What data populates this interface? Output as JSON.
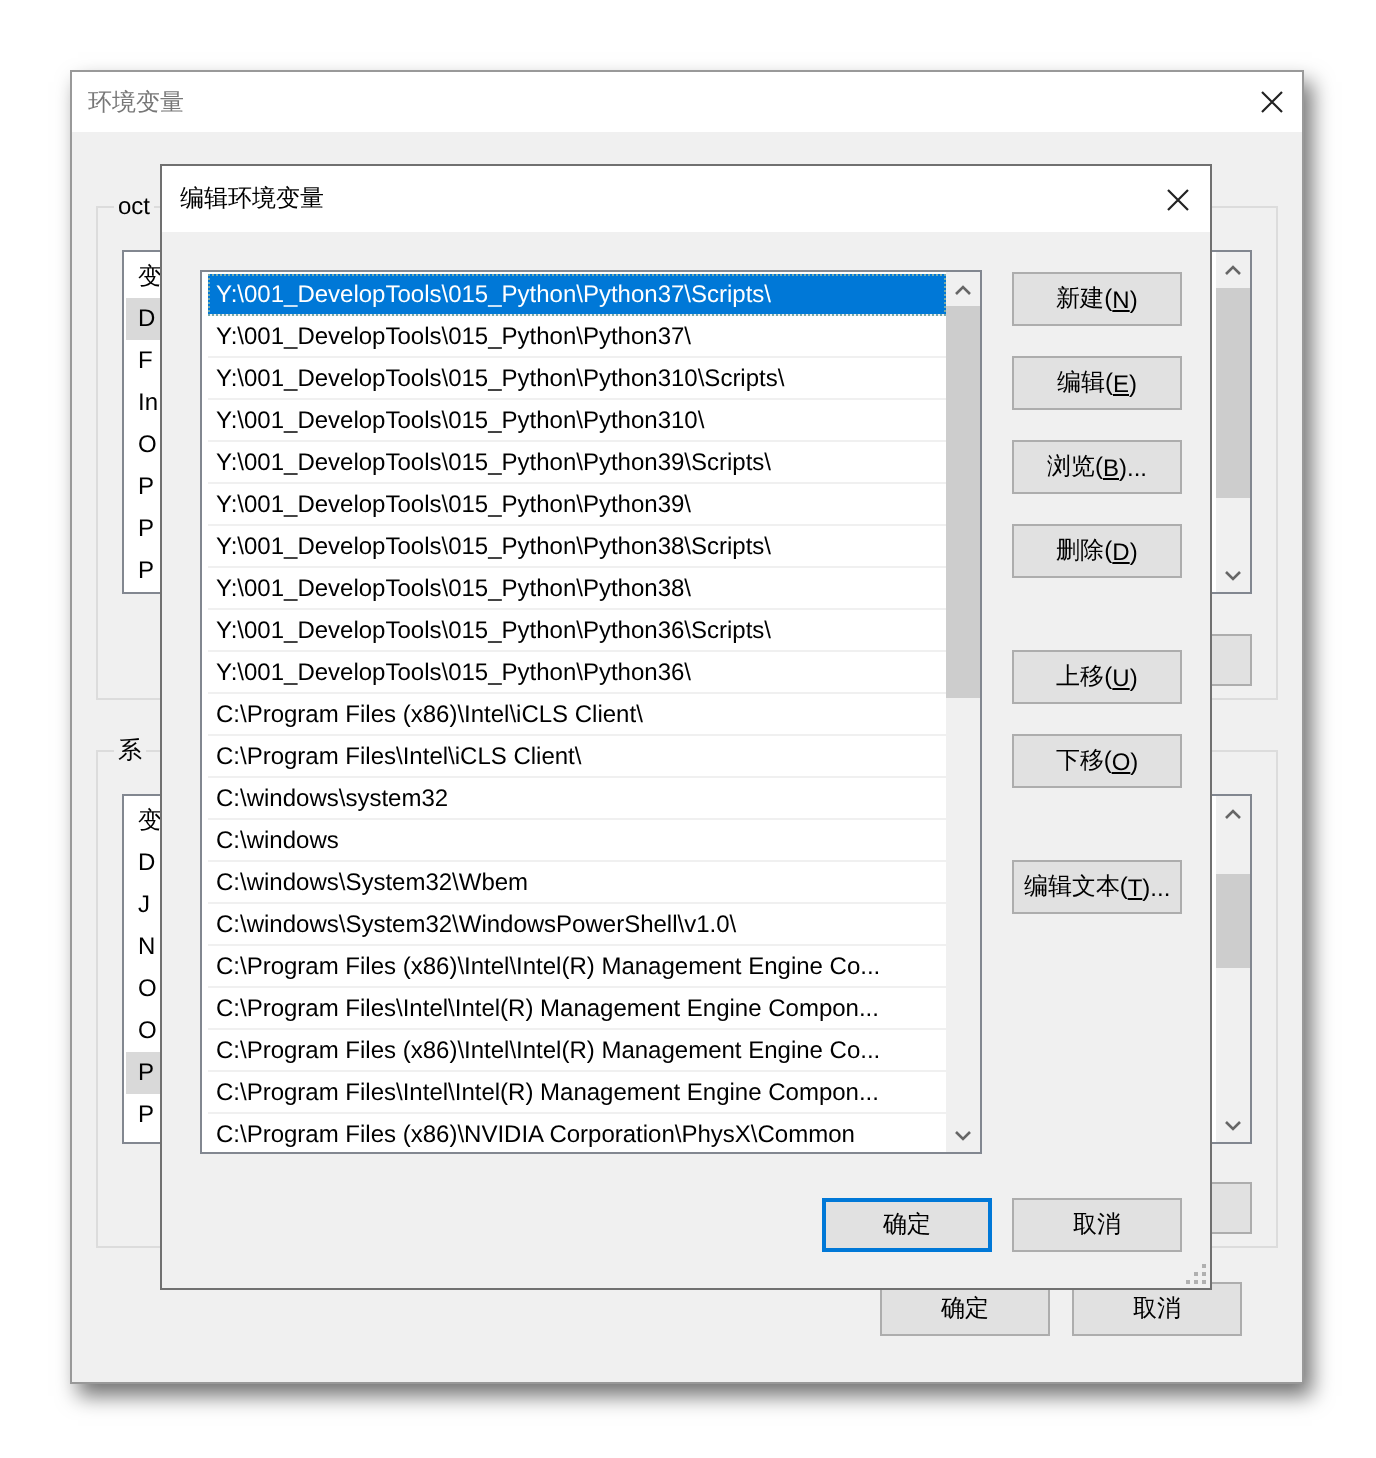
{
  "window": {
    "title": "环境变量",
    "user_group": {
      "label": "oct",
      "header": "变",
      "rows": [
        {
          "text": "D",
          "selected": true
        },
        {
          "text": "F",
          "selected": false
        },
        {
          "text": "In",
          "selected": false
        },
        {
          "text": "O",
          "selected": false
        },
        {
          "text": "P",
          "selected": false
        },
        {
          "text": "P",
          "selected": false
        },
        {
          "text": "P",
          "selected": false
        }
      ]
    },
    "system_group": {
      "label": "系",
      "header": "变",
      "rows": [
        {
          "text": "D",
          "selected": false
        },
        {
          "text": "J",
          "selected": false
        },
        {
          "text": "N",
          "selected": false
        },
        {
          "text": "O",
          "selected": false
        },
        {
          "text": "O",
          "selected": false
        },
        {
          "text": "P",
          "selected": true
        },
        {
          "text": "P",
          "selected": false
        }
      ]
    },
    "buttons": [
      {
        "label": "确定"
      },
      {
        "label": "取消"
      }
    ]
  },
  "dialog": {
    "title": "编辑环境变量",
    "paths": [
      {
        "text": "Y:\\001_DevelopTools\\015_Python\\Python37\\Scripts\\",
        "selected": true
      },
      {
        "text": "Y:\\001_DevelopTools\\015_Python\\Python37\\",
        "selected": false
      },
      {
        "text": "Y:\\001_DevelopTools\\015_Python\\Python310\\Scripts\\",
        "selected": false
      },
      {
        "text": "Y:\\001_DevelopTools\\015_Python\\Python310\\",
        "selected": false
      },
      {
        "text": "Y:\\001_DevelopTools\\015_Python\\Python39\\Scripts\\",
        "selected": false
      },
      {
        "text": "Y:\\001_DevelopTools\\015_Python\\Python39\\",
        "selected": false
      },
      {
        "text": "Y:\\001_DevelopTools\\015_Python\\Python38\\Scripts\\",
        "selected": false
      },
      {
        "text": "Y:\\001_DevelopTools\\015_Python\\Python38\\",
        "selected": false
      },
      {
        "text": "Y:\\001_DevelopTools\\015_Python\\Python36\\Scripts\\",
        "selected": false
      },
      {
        "text": "Y:\\001_DevelopTools\\015_Python\\Python36\\",
        "selected": false
      },
      {
        "text": "C:\\Program Files (x86)\\Intel\\iCLS Client\\",
        "selected": false
      },
      {
        "text": "C:\\Program Files\\Intel\\iCLS Client\\",
        "selected": false
      },
      {
        "text": "C:\\windows\\system32",
        "selected": false
      },
      {
        "text": "C:\\windows",
        "selected": false
      },
      {
        "text": "C:\\windows\\System32\\Wbem",
        "selected": false
      },
      {
        "text": "C:\\windows\\System32\\WindowsPowerShell\\v1.0\\",
        "selected": false
      },
      {
        "text": "C:\\Program Files (x86)\\Intel\\Intel(R) Management Engine Co...",
        "selected": false
      },
      {
        "text": "C:\\Program Files\\Intel\\Intel(R) Management Engine Compon...",
        "selected": false
      },
      {
        "text": "C:\\Program Files (x86)\\Intel\\Intel(R) Management Engine Co...",
        "selected": false
      },
      {
        "text": "C:\\Program Files\\Intel\\Intel(R) Management Engine Compon...",
        "selected": false
      },
      {
        "text": "C:\\Program Files (x86)\\NVIDIA Corporation\\PhysX\\Common",
        "selected": false
      }
    ],
    "side_button_groups": [
      [
        {
          "label": "新建(",
          "access_key": "N",
          "label_end": ")"
        },
        {
          "label": "编辑(",
          "access_key": "E",
          "label_end": ")"
        },
        {
          "label": "浏览(",
          "access_key": "B",
          "label_end": ")..."
        },
        {
          "label": "删除(",
          "access_key": "D",
          "label_end": ")"
        }
      ],
      [
        {
          "label": "上移(",
          "access_key": "U",
          "label_end": ")"
        },
        {
          "label": "下移(",
          "access_key": "O",
          "label_end": ")"
        }
      ],
      [
        {
          "label": "编辑文本(",
          "access_key": "T",
          "label_end": ")..."
        }
      ]
    ],
    "buttons": [
      {
        "label": "确定",
        "default": true
      },
      {
        "label": "取消",
        "default": false
      }
    ]
  }
}
